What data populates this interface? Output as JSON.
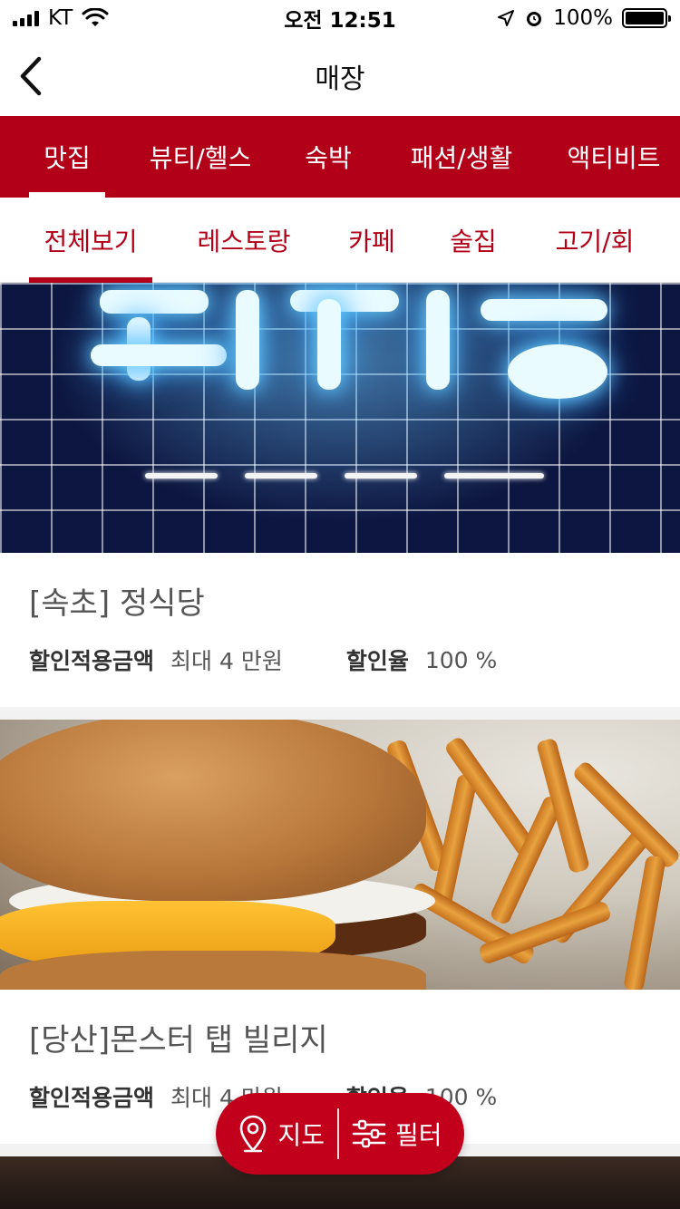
{
  "status_bar": {
    "carrier": "KT",
    "time": "오전 12:51",
    "battery": "100%",
    "battery_level": 1.0
  },
  "nav": {
    "title": "매장",
    "back_icon": "chevron-left-icon"
  },
  "category_tabs": [
    {
      "label": "맛집",
      "active": true
    },
    {
      "label": "뷰티/헬스",
      "active": false
    },
    {
      "label": "숙박",
      "active": false
    },
    {
      "label": "패션/생활",
      "active": false
    },
    {
      "label": "액티비트",
      "active": false
    }
  ],
  "sub_tabs": [
    {
      "label": "전체보기",
      "active": true
    },
    {
      "label": "레스토랑",
      "active": false
    },
    {
      "label": "카페",
      "active": false
    },
    {
      "label": "술집",
      "active": false
    },
    {
      "label": "고기/회",
      "active": false
    }
  ],
  "stores": [
    {
      "name": "[속초] 정식당",
      "discount_amount_label": "할인적용금액",
      "discount_amount": "최대 4 만원",
      "discount_rate_label": "할인율",
      "discount_rate": "100 %"
    },
    {
      "name": "[당산]몬스터 탭 빌리지",
      "discount_amount_label": "할인적용금액",
      "discount_amount": "최대 4 만원",
      "discount_rate_label": "할인율",
      "discount_rate": "100 %"
    }
  ],
  "floating": {
    "map_label": "지도",
    "filter_label": "필터",
    "map_icon": "map-pin-icon",
    "filter_icon": "sliders-icon"
  },
  "colors": {
    "brand": "#b10018",
    "pill": "#c3001c"
  }
}
